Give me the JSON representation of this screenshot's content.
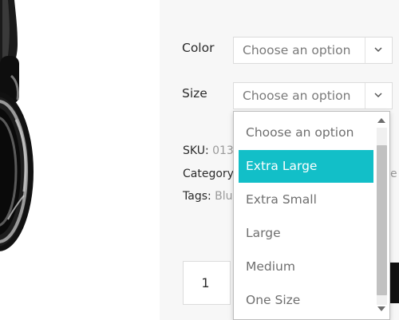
{
  "product": {
    "image_alt": "headphones"
  },
  "variations": {
    "color": {
      "label": "Color",
      "value": "Choose an option"
    },
    "size": {
      "label": "Size",
      "value": "Choose an option"
    }
  },
  "size_dropdown": {
    "options": [
      "Choose an option",
      "Extra Large",
      "Extra Small",
      "Large",
      "Medium",
      "One Size"
    ],
    "highlighted": "Extra Large",
    "highlight_color": "#12bfc8"
  },
  "meta": {
    "sku": {
      "key": "SKU:",
      "value": "013"
    },
    "category": {
      "key": "Category",
      "value": "e"
    },
    "tags": {
      "key": "Tags:",
      "value": "Blu"
    }
  },
  "quantity": {
    "value": "1"
  }
}
